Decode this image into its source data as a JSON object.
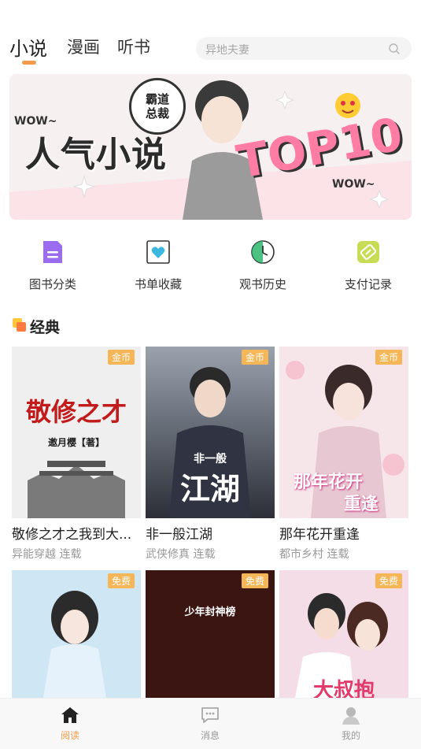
{
  "header": {
    "tabs": [
      {
        "label": "小说",
        "active": true
      },
      {
        "label": "漫画",
        "active": false
      },
      {
        "label": "听书",
        "active": false
      }
    ],
    "search": {
      "placeholder": "异地夫妻",
      "icon": "search-icon"
    }
  },
  "banner": {
    "main_text": "人气小说",
    "top_text": "TOP10",
    "wow_left": "WOW~",
    "wow_right": "WOW~",
    "sign_line1": "霸道",
    "sign_line2": "总裁"
  },
  "shortcuts": [
    {
      "label": "图书分类",
      "icon": "document-icon"
    },
    {
      "label": "书单收藏",
      "icon": "heart-icon"
    },
    {
      "label": "观书历史",
      "icon": "clock-icon"
    },
    {
      "label": "支付记录",
      "icon": "ticket-icon"
    }
  ],
  "section": {
    "title": "经典"
  },
  "books": [
    {
      "name": "敬修之才之我到大...",
      "meta": "异能穿越 连载",
      "badge": "金币",
      "cover_text": "敬修之才",
      "cover_sub": "邀月樱【著】"
    },
    {
      "name": "非一般江湖",
      "meta": "武侠修真 连载",
      "badge": "金币",
      "cover_text": "江湖",
      "cover_sub": "非一般"
    },
    {
      "name": "那年花开重逢",
      "meta": "都市乡村 连载",
      "badge": "金币",
      "cover_text": "那年花开",
      "cover_sub": "重逢"
    },
    {
      "badge": "免费",
      "cover_text": "",
      "cover_sub": ""
    },
    {
      "badge": "免费",
      "cover_text": "少年封神榜",
      "cover_sub": ""
    },
    {
      "badge": "免费",
      "cover_text": "大叔抱",
      "cover_sub": ""
    }
  ],
  "bottom_nav": [
    {
      "label": "阅读",
      "icon": "home-icon",
      "active": true
    },
    {
      "label": "消息",
      "icon": "message-icon",
      "active": false
    },
    {
      "label": "我的",
      "icon": "profile-icon",
      "active": false
    }
  ],
  "colors": {
    "accent": "#f39a4a",
    "badge": "#f5b658",
    "shortcut_purple": "#9b6cf0",
    "shortcut_blue": "#3cb8e0",
    "shortcut_green": "#2bb76b",
    "shortcut_yellow": "#c9dc55"
  }
}
